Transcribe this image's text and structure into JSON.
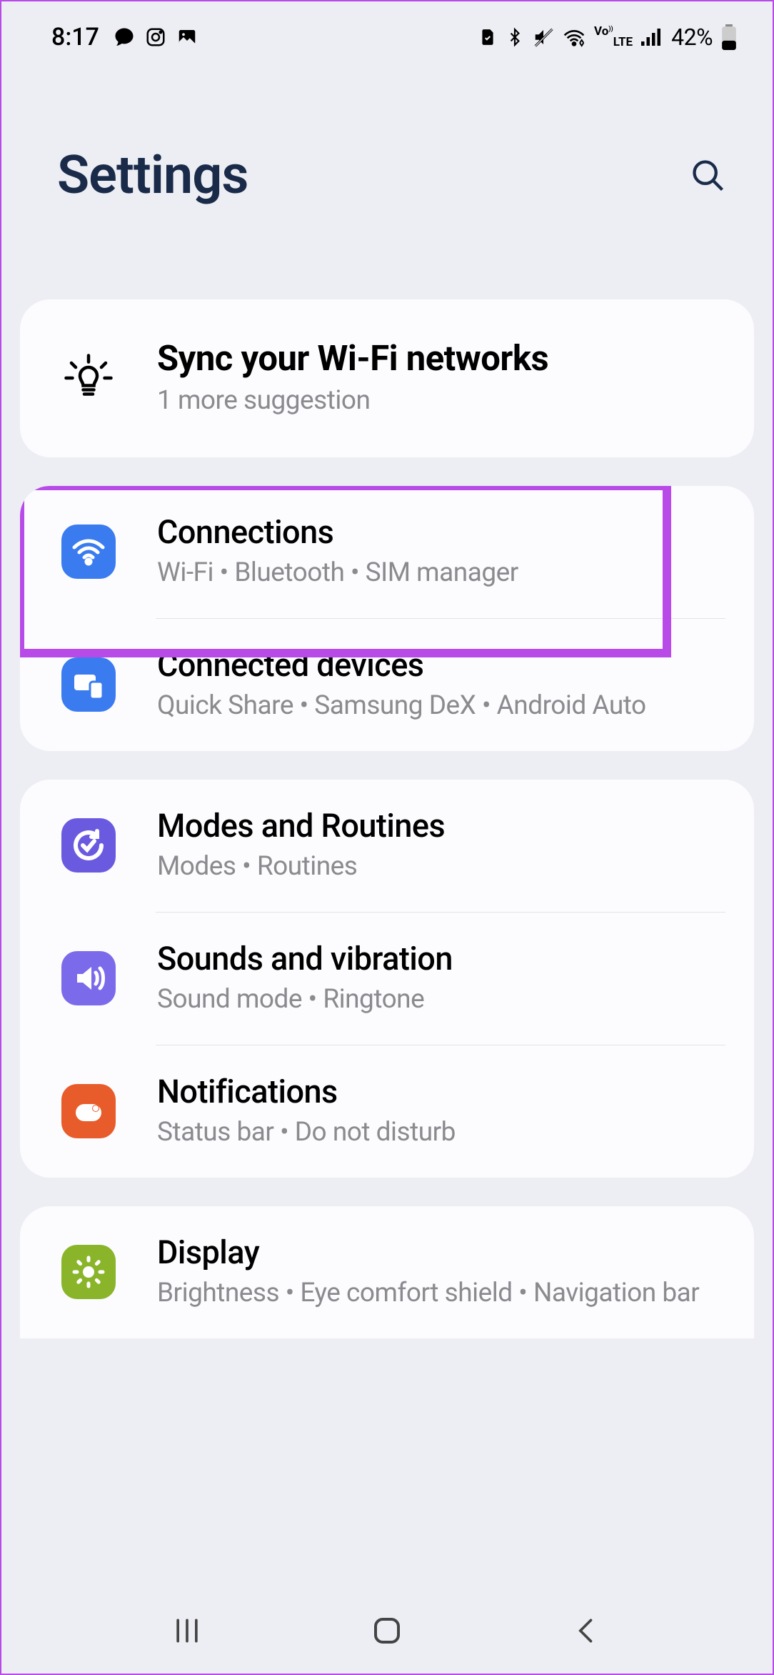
{
  "status": {
    "time": "8:17",
    "battery_pct": "42%"
  },
  "header": {
    "title": "Settings"
  },
  "suggestion": {
    "title": "Sync your Wi-Fi networks",
    "sub": "1 more suggestion"
  },
  "groups": [
    {
      "items": [
        {
          "key": "connections",
          "title": "Connections",
          "sub": "Wi-Fi  •  Bluetooth  •  SIM manager",
          "color": "bg-blue",
          "icon": "wifi"
        },
        {
          "key": "connected-devices",
          "title": "Connected devices",
          "sub": "Quick Share  •  Samsung DeX  •  Android Auto",
          "color": "bg-blue",
          "icon": "devices"
        }
      ]
    },
    {
      "items": [
        {
          "key": "modes-routines",
          "title": "Modes and Routines",
          "sub": "Modes  •  Routines",
          "color": "bg-purple",
          "icon": "routines"
        },
        {
          "key": "sounds-vibration",
          "title": "Sounds and vibration",
          "sub": "Sound mode  •  Ringtone",
          "color": "bg-violet",
          "icon": "sound"
        },
        {
          "key": "notifications",
          "title": "Notifications",
          "sub": "Status bar  •  Do not disturb",
          "color": "bg-orange",
          "icon": "notifications"
        }
      ]
    },
    {
      "items": [
        {
          "key": "display",
          "title": "Display",
          "sub": "Brightness  •  Eye comfort shield  •  Navigation bar",
          "color": "bg-green",
          "icon": "brightness"
        }
      ]
    }
  ],
  "highlight_target": "connections"
}
